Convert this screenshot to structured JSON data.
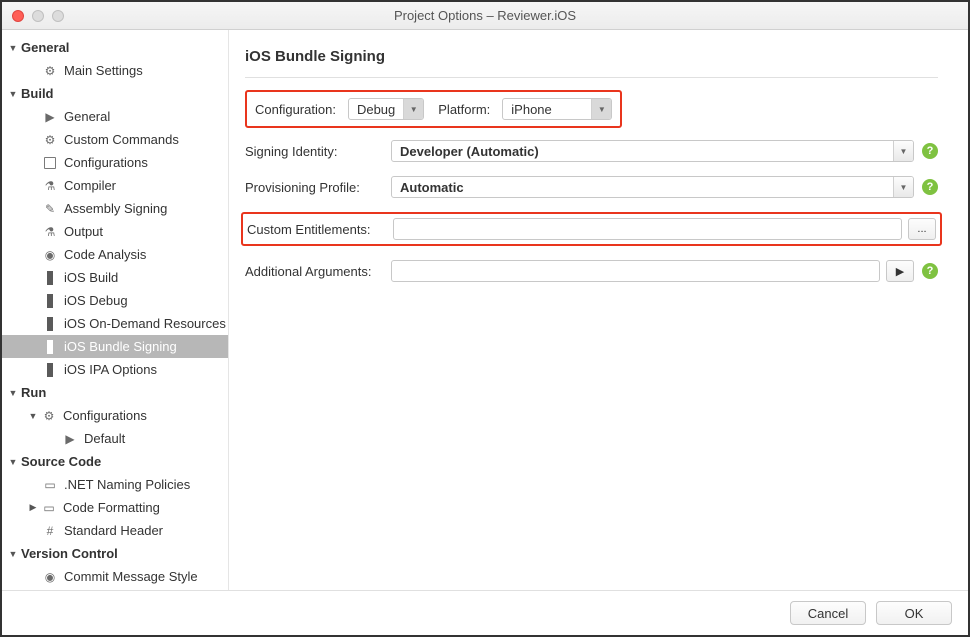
{
  "window": {
    "title": "Project Options – Reviewer.iOS"
  },
  "sidebar": {
    "general": {
      "label": "General",
      "items": {
        "main_settings": "Main Settings"
      }
    },
    "build": {
      "label": "Build",
      "items": {
        "general": "General",
        "custom_commands": "Custom Commands",
        "configurations": "Configurations",
        "compiler": "Compiler",
        "assembly_signing": "Assembly Signing",
        "output": "Output",
        "code_analysis": "Code Analysis",
        "ios_build": "iOS Build",
        "ios_debug": "iOS Debug",
        "ios_on_demand": "iOS On-Demand Resources",
        "ios_bundle_signing": "iOS Bundle Signing",
        "ios_ipa_options": "iOS IPA Options"
      }
    },
    "run": {
      "label": "Run",
      "items": {
        "configurations": "Configurations",
        "default": "Default"
      }
    },
    "source_code": {
      "label": "Source Code",
      "items": {
        "net_naming": ".NET Naming Policies",
        "code_formatting": "Code Formatting",
        "standard_header": "Standard Header"
      }
    },
    "version_control": {
      "label": "Version Control",
      "items": {
        "commit_style": "Commit Message Style"
      }
    }
  },
  "main": {
    "title": "iOS Bundle Signing",
    "configuration_label": "Configuration:",
    "configuration_value": "Debug",
    "platform_label": "Platform:",
    "platform_value": "iPhone",
    "signing_identity_label": "Signing Identity:",
    "signing_identity_value": "Developer (Automatic)",
    "provisioning_label": "Provisioning Profile:",
    "provisioning_value": "Automatic",
    "custom_entitlements_label": "Custom Entitlements:",
    "custom_entitlements_value": "",
    "browse_label": "...",
    "additional_args_label": "Additional Arguments:",
    "additional_args_value": "",
    "arrow_btn": "▶"
  },
  "footer": {
    "cancel": "Cancel",
    "ok": "OK"
  }
}
